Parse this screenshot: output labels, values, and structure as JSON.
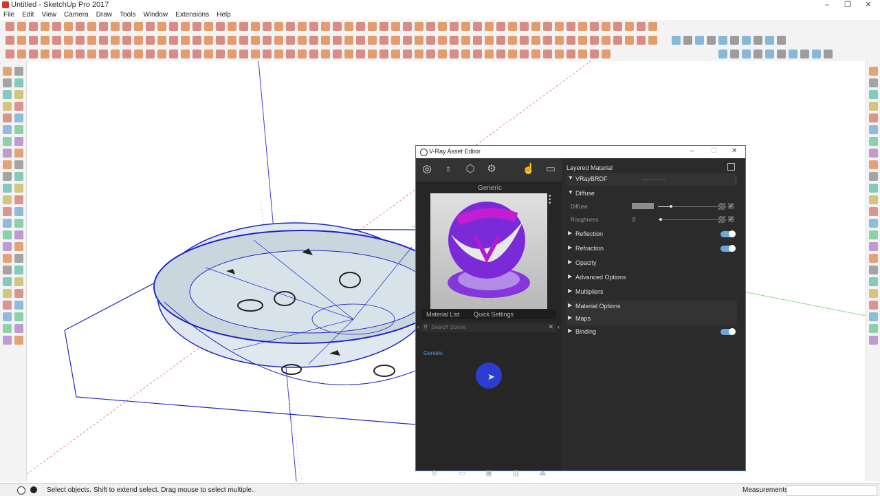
{
  "app": {
    "title": "Untitled - SketchUp Pro 2017",
    "menu": [
      "File",
      "Edit",
      "View",
      "Camera",
      "Draw",
      "Tools",
      "Window",
      "Extensions",
      "Help"
    ]
  },
  "status": {
    "message": "Select objects. Shift to extend select. Drag mouse to select multiple.",
    "measurements_label": "Measurements",
    "measurements_value": ""
  },
  "vray": {
    "window_title": "V-Ray Asset Editor",
    "preview_label": "Generic",
    "tabs": {
      "material_list": "Material List",
      "quick_settings": "Quick Settings"
    },
    "search_placeholder": "Search Scene",
    "materials": [
      "Generic"
    ],
    "right": {
      "header": "Layered Material",
      "brdf_label": "VRayBRDF",
      "diffuse_section": "Diffuse",
      "diffuse_label": "Diffuse",
      "roughness_label": "Roughness",
      "roughness_value": "0",
      "diffuse_color": "#8d8d8d",
      "sections": {
        "reflection": "Reflection",
        "refraction": "Refraction",
        "opacity": "Opacity",
        "advanced": "Advanced Options",
        "multipliers": "Multipliers",
        "material_options": "Material Options",
        "maps": "Maps",
        "binding": "Binding"
      },
      "toggles_on": {
        "reflection": true,
        "refraction": true,
        "binding": true
      }
    }
  },
  "colors": {
    "accent": "#3a7bd5",
    "toggle": "#6da8d9",
    "cursor_highlight": "#2c3ee0",
    "model_edges": "#1f24c8"
  }
}
